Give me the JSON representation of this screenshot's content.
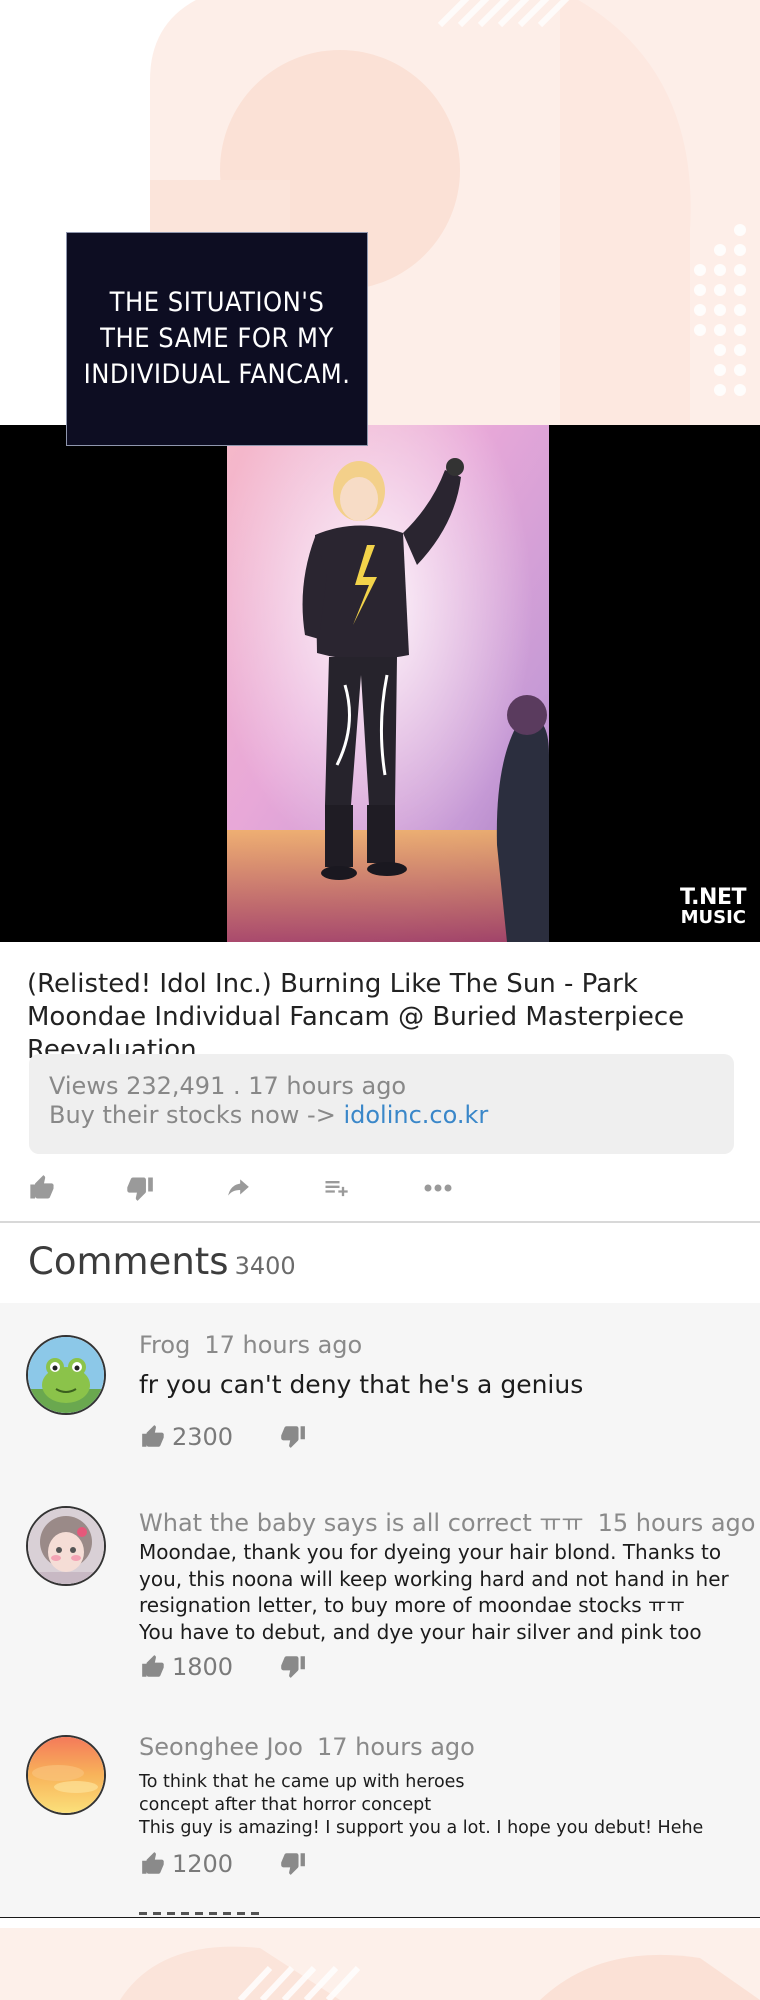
{
  "caption": {
    "text": "THE SITUATION'S\nTHE SAME FOR MY\nINDIVIDUAL FANCAM."
  },
  "video": {
    "watermark_line1": "T.NET",
    "watermark_line2": "MUSIC"
  },
  "title": "(Relisted! Idol Inc.) Burning Like The Sun - Park Moondae Individual Fancam @ Buried Masterpiece Reevaluation",
  "info": {
    "views": "Views 232,491 . 17 hours ago",
    "promo": "Buy their stocks now -> ",
    "link": "idolinc.co.kr"
  },
  "actions": [
    {
      "name": "like",
      "icon": "thumbs-up-icon"
    },
    {
      "name": "dislike",
      "icon": "thumbs-down-icon"
    },
    {
      "name": "share",
      "icon": "share-icon"
    },
    {
      "name": "save",
      "icon": "playlist-add-icon"
    },
    {
      "name": "more",
      "icon": "more-icon"
    }
  ],
  "comments_header": {
    "title": "Comments",
    "count": "3400"
  },
  "comments": [
    {
      "user": "Frog",
      "time": "17 hours ago",
      "text": "fr you can't deny that he's a genius",
      "likes": "2300"
    },
    {
      "user": "What the baby says is all correct ㅠㅠ",
      "time": "15 hours ago",
      "text": "Moondae, thank you for dyeing your hair blond. Thanks to you, this noona will keep working hard and not hand in her resignation letter, to buy more of moondae stocks ㅠㅠ\nYou have to debut, and dye your hair silver and pink too",
      "likes": "1800"
    },
    {
      "user": "Seonghee Joo",
      "time": "17 hours ago",
      "text": "To think that he came up with heroes\nconcept after that horror concept\nThis guy is amazing! I support you a lot. I hope you debut! Hehe",
      "likes": "1200"
    }
  ],
  "colors": {
    "link": "#3a87c9",
    "panel": "#f6f6f6",
    "caption_bg": "#0d0d22"
  }
}
